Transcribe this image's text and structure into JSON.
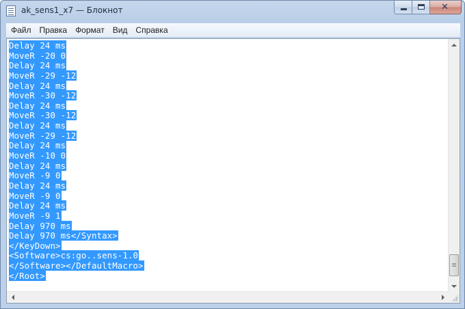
{
  "window": {
    "title": "ak_sens1_x7 — Блокнот",
    "app_icon": "notepad-icon"
  },
  "caption_buttons": {
    "minimize_icon": "minimize-icon",
    "maximize_icon": "maximize-icon",
    "close_icon": "close-icon",
    "close_glyph": "✕"
  },
  "menu": {
    "items": [
      "Файл",
      "Правка",
      "Формат",
      "Вид",
      "Справка"
    ]
  },
  "editor": {
    "selection_color": "#3399ff",
    "lines": [
      "Delay 24 ms",
      "MoveR -20 0",
      "Delay 24 ms",
      "MoveR -29 -12",
      "Delay 24 ms",
      "MoveR -30 -12",
      "Delay 24 ms",
      "MoveR -30 -12",
      "Delay 24 ms",
      "MoveR -29 -12",
      "Delay 24 ms",
      "MoveR -10 0",
      "Delay 24 ms",
      "MoveR -9 0",
      "Delay 24 ms",
      "MoveR -9 0",
      "Delay 24 ms",
      "MoveR -9 1",
      "Delay 970 ms",
      "Delay 970 ms</Syntax>",
      "</KeyDown>",
      "<Software>cs:go..sens-1.0",
      "</Software></DefaultMacro>",
      "</Root>"
    ]
  }
}
